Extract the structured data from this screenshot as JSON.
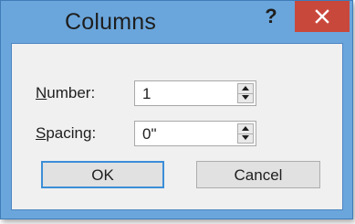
{
  "window": {
    "title": "Columns",
    "help_label": "?",
    "close_icon": "close-icon"
  },
  "fields": {
    "number": {
      "label_accel": "N",
      "label_rest": "umber:",
      "value": "1"
    },
    "spacing": {
      "label_accel": "S",
      "label_rest": "pacing:",
      "value": "0\""
    }
  },
  "buttons": {
    "ok_label": "OK",
    "cancel_label": "Cancel"
  },
  "colors": {
    "frame": "#6aa6dc",
    "close": "#c9483c",
    "client": "#f0f0f0",
    "default_button_border": "#3c8ed7"
  }
}
